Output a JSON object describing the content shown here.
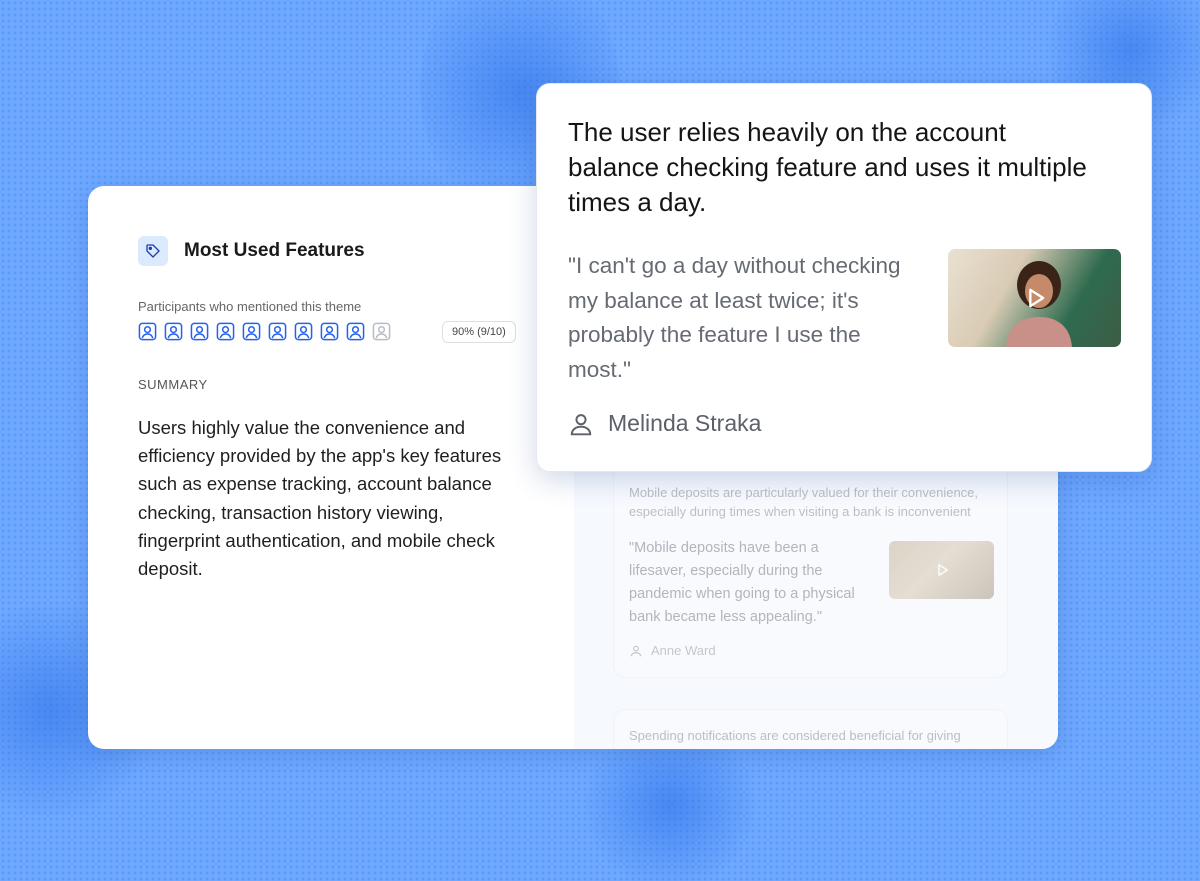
{
  "theme": {
    "title": "Most Used Features",
    "icon": "tag-icon",
    "participants_label": "Participants who mentioned this theme",
    "participants_total": 10,
    "participants_mentioned": 9,
    "percent_chip": "90% (9/10)",
    "summary_label": "SUMMARY",
    "summary_text": "Users highly value the convenience and efficiency provided by the app's key features such as expense tracking, account balance checking, transaction history viewing, fingerprint authentication, and mobile check deposit."
  },
  "insight_popup": {
    "headline": "The user relies heavily on the account balance checking feature and uses it multiple times a day.",
    "quote": "\"I can't go a day without checking my balance at least twice; it's probably the feature I use the most.\"",
    "author": "Melinda Straka",
    "author_icon": "user-icon",
    "video_icon": "play-icon"
  },
  "insights": [
    {
      "headline": "Mobile deposits are particularly valued for their convenience, especially during times when visiting a bank is inconvenient",
      "quote": "\"Mobile deposits have been a lifesaver, especially during the pandemic when going to a physical bank became less appealing.\"",
      "author": "Anne Ward"
    },
    {
      "headline": "Spending notifications are considered beneficial for giving"
    }
  ],
  "colors": {
    "background": "#6ea8ff",
    "accent": "#2563eb",
    "badge_bg": "#dceafd"
  }
}
